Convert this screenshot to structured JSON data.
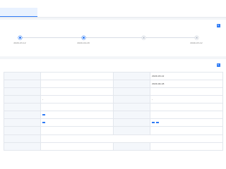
{
  "header": {
    "title": "",
    "subtitle": ""
  },
  "tabs": [
    {
      "label": "",
      "active": true
    },
    {
      "label": "",
      "active": false
    },
    {
      "label": "",
      "active": false
    },
    {
      "label": "",
      "active": false
    },
    {
      "label": "",
      "active": false
    },
    {
      "label": "",
      "active": false
    }
  ],
  "progress": {
    "title": "",
    "action_label": "",
    "action_icon": "edit-icon",
    "steps": [
      {
        "label": "",
        "date": "2020-03-12",
        "done": true
      },
      {
        "label": "",
        "date": "2020-04-18",
        "done": true
      },
      {
        "label": "",
        "date": "",
        "done": false
      },
      {
        "label": "",
        "date": "2040-03-12",
        "done": false
      }
    ]
  },
  "detail": {
    "title": "",
    "subtitle": "",
    "action_label": "",
    "rows": [
      [
        {
          "k": "",
          "v": ""
        },
        {
          "k": "",
          "v": "2020-03-12"
        }
      ],
      [
        {
          "k": "",
          "v": ""
        },
        {
          "k": "",
          "v": "2020-04-18"
        }
      ],
      [
        {
          "k": "",
          "v": ""
        },
        {
          "k": "",
          "v": ""
        }
      ],
      [
        {
          "k": "",
          "v": "-"
        },
        {
          "k": "",
          "v": "-"
        }
      ],
      [
        {
          "k": "",
          "v": ""
        },
        {
          "k": "",
          "v": ""
        }
      ],
      [
        {
          "k": "",
          "v": ""
        },
        {
          "k": "",
          "v": ""
        }
      ],
      [
        {
          "k": "",
          "v": ""
        },
        {
          "k": "",
          "v": ""
        }
      ],
      [
        {
          "k": "",
          "v": ""
        },
        {
          "k": "",
          "v": ""
        }
      ],
      [
        {
          "k": "",
          "v": ""
        },
        {
          "k": "",
          "v": ""
        }
      ],
      [
        {
          "k": "",
          "v": ""
        },
        {
          "k": "",
          "v": ""
        }
      ]
    ],
    "status_tags": [
      "",
      ""
    ],
    "right_tags": [
      "",
      "",
      "",
      "",
      ""
    ],
    "link_row_value": ""
  },
  "colors": {
    "accent": "#2f7bf5",
    "step_inactive": "#c8ced8",
    "key_bg": "#f4f7fb"
  }
}
